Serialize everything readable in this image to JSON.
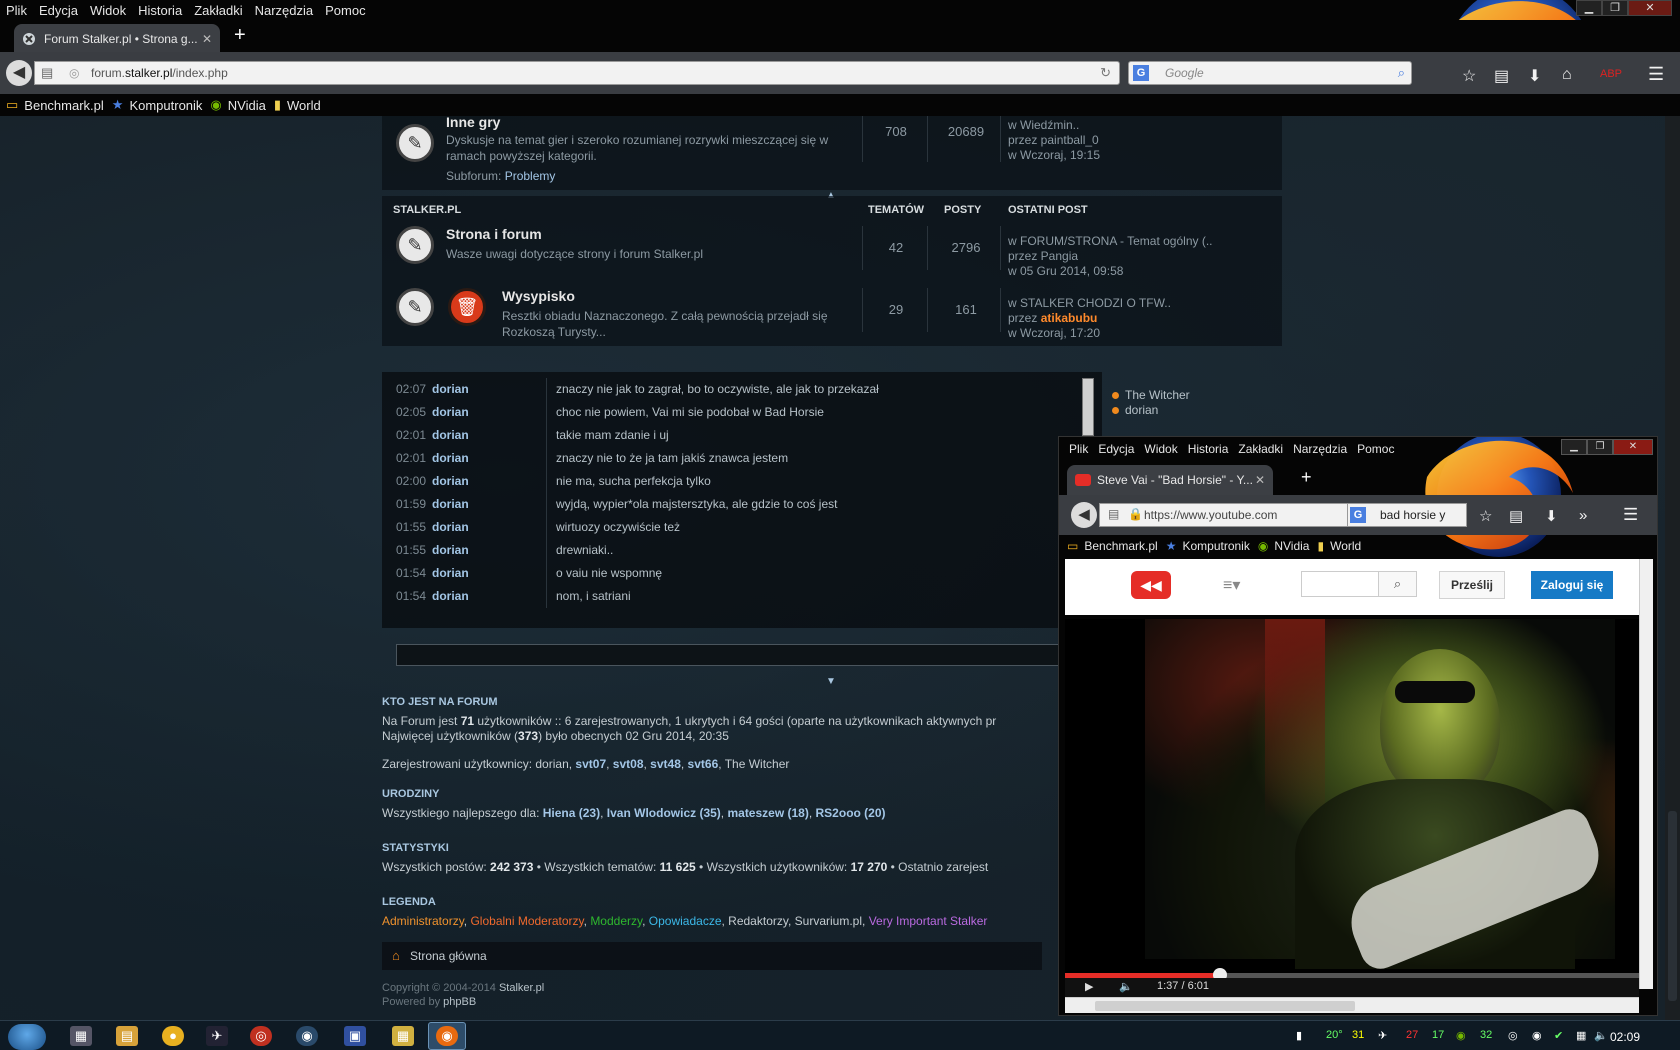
{
  "browser": {
    "menu": [
      "Plik",
      "Edycja",
      "Widok",
      "Historia",
      "Zakładki",
      "Narzędzia",
      "Pomoc"
    ],
    "tab_title": "Forum Stalker.pl • Strona g...",
    "tab_close": "✕",
    "new_tab": "+",
    "url_prefix": "forum.",
    "url_domain": "stalker.pl",
    "url_path": "/index.php",
    "search_engine_icon": "G",
    "search_placeholder": "Google",
    "bookmarks": [
      {
        "icon": "folder-icon",
        "label": "Benchmark.pl"
      },
      {
        "icon": "star-icon",
        "label": "Komputronik"
      },
      {
        "icon": "nvidia-icon",
        "label": "NVidia"
      },
      {
        "icon": "folder-icon",
        "label": "World"
      }
    ],
    "win_controls": [
      "▁",
      "❐",
      "✕"
    ]
  },
  "forum": {
    "inne_gry": {
      "title": "Inne gry",
      "desc_line1": "Dyskusje na temat gier i szeroko rozumianej rozrywki mieszczącej się w",
      "desc_line2": "ramach powyższej kategorii.",
      "subforum_label": "Subforum:",
      "subforum_link": "Problemy",
      "topics": "708",
      "posts": "20689",
      "last_in": "w Wiedźmin..",
      "last_by": "przez paintball_0",
      "last_when": "w Wczoraj, 19:15"
    },
    "category": "STALKER.PL",
    "col_topics": "TEMATÓW",
    "col_posts": "POSTY",
    "col_last": "OSTATNI POST",
    "strona": {
      "title": "Strona i forum",
      "desc": "Wasze uwagi dotyczące strony i forum Stalker.pl",
      "topics": "42",
      "posts": "2796",
      "last_in": "w FORUM/STRONA - Temat ogólny (..",
      "last_by": "przez Pangia",
      "last_when": "w 05 Gru 2014, 09:58"
    },
    "wysypisko": {
      "title": "Wysypisko",
      "desc_line1": "Resztki obiadu Naznaczonego. Z całą pewnością przejadł się",
      "desc_line2": "Rozkoszą Turysty...",
      "topics": "29",
      "posts": "161",
      "last_in": "w STALKER CHODZI O TFW..",
      "last_by_label": "przez",
      "last_by_user": "atikabubu",
      "last_when": "w Wczoraj, 17:20"
    }
  },
  "shoutbox": {
    "rows": [
      {
        "time": "02:07",
        "user": "dorian",
        "msg": "znaczy nie jak to zagrał, bo to oczywiste, ale jak to przekazał"
      },
      {
        "time": "02:05",
        "user": "dorian",
        "msg": "choc nie powiem, Vai mi sie podobał w Bad Horsie"
      },
      {
        "time": "02:01",
        "user": "dorian",
        "msg": "takie mam zdanie i uj"
      },
      {
        "time": "02:01",
        "user": "dorian",
        "msg": "znaczy nie to że ja tam jakiś znawca jestem"
      },
      {
        "time": "02:00",
        "user": "dorian",
        "msg": "nie ma, sucha perfekcja tylko"
      },
      {
        "time": "01:59",
        "user": "dorian",
        "msg": "wyjdą, wypier*ola majstersztyka, ale gdzie to coś jest"
      },
      {
        "time": "01:55",
        "user": "dorian",
        "msg": "wirtuozy oczywiście też"
      },
      {
        "time": "01:55",
        "user": "dorian",
        "msg": "drewniaki.."
      },
      {
        "time": "01:54",
        "user": "dorian",
        "msg": "o vaiu nie wspomnę"
      },
      {
        "time": "01:54",
        "user": "dorian",
        "msg": "nom, i satriani"
      }
    ],
    "online": [
      "The Witcher",
      "dorian"
    ]
  },
  "stats": {
    "who_h": "KTO JEST NA FORUM",
    "who_l1_a": "Na Forum jest ",
    "who_l1_b": "71",
    "who_l1_c": " użytkowników :: 6 zarejestrowanych, 1 ukrytych i 64 gości (oparte na użytkownikach aktywnych pr",
    "who_l2_a": "Najwięcej użytkowników (",
    "who_l2_b": "373",
    "who_l2_c": ") było obecnych 02 Gru 2014, 20:35",
    "registered_label": "Zarejestrowani użytkownicy: dorian, ",
    "registered_users": [
      "svt07",
      "svt08",
      "svt48",
      "svt66"
    ],
    "registered_last": "The Witcher",
    "bday_h": "URODZINY",
    "bday_label": "Wszystkiego najlepszego dla: ",
    "bday_users": [
      "Hiena (23)",
      "Ivan Wlodowicz (35)",
      "mateszew (18)",
      "RS2ooo (20)"
    ],
    "stat_h": "STATYSTYKI",
    "stat_posts_label": "Wszystkich postów: ",
    "stat_posts": "242 373",
    "stat_topics_label": " • Wszystkich tematów: ",
    "stat_topics": "11 625",
    "stat_users_label": " • Wszystkich użytkowników: ",
    "stat_users": "17 270",
    "stat_tail": " • Ostatnio zarejest",
    "legend_h": "LEGENDA",
    "legend": [
      {
        "label": "Administratorzy",
        "color": "#f0922e"
      },
      {
        "label": "Globalni Moderatorzy",
        "color": "#f06a2e"
      },
      {
        "label": "Modderzy",
        "color": "#2eb82e"
      },
      {
        "label": "Opowiadacze",
        "color": "#3cb8e8"
      },
      {
        "label": "Redaktorzy",
        "color": "#c5cdd2"
      },
      {
        "label": "Survarium.pl",
        "color": "#c5cdd2"
      },
      {
        "label": "Very Important Stalker",
        "color": "#b96ae0"
      }
    ],
    "home": "Strona główna",
    "copy1_a": "Copyright © 2004-2014 ",
    "copy1_b": "Stalker.pl",
    "copy2_a": "Powered by ",
    "copy2_b": "phpBB"
  },
  "mini": {
    "menu": [
      "Plik",
      "Edycja",
      "Widok",
      "Historia",
      "Zakładki",
      "Narzędzia",
      "Pomoc"
    ],
    "tab_title": "Steve Vai - \"Bad Horsie\" - Y...",
    "url": "https://www.youtube.com",
    "search_value": "bad horsie y",
    "bookmarks": [
      "Benchmark.pl",
      "Komputronik",
      "NVidia",
      "World"
    ],
    "yt_upload": "Prześlij",
    "yt_signin": "Zaloguj się",
    "video_time": "1:37 / 6:01",
    "progress_fraction": 0.27
  },
  "taskbar": {
    "tray": [
      "20°",
      "31",
      "27",
      "17",
      "32"
    ],
    "clock": "02:09"
  }
}
